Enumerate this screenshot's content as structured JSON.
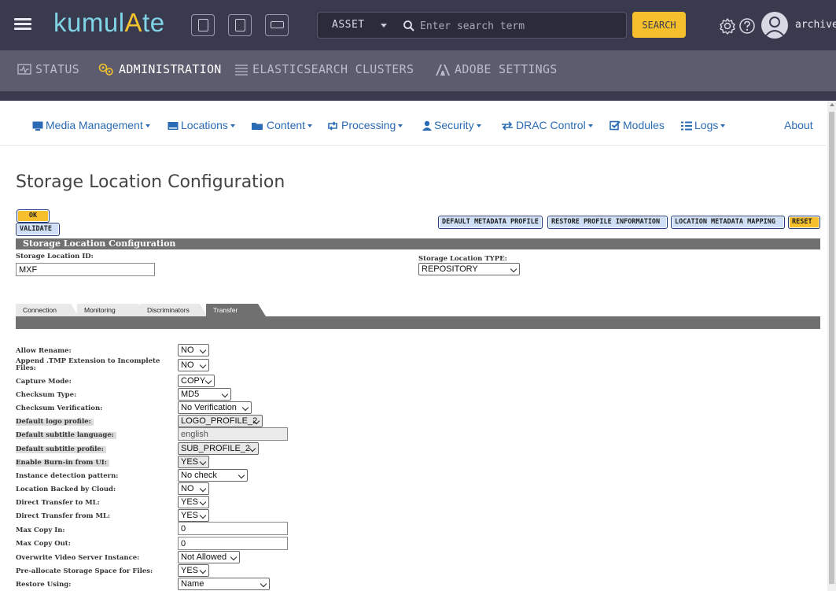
{
  "app": {
    "logo_text_1": "kumul",
    "logo_text_2": "A",
    "logo_text_3": "te",
    "user": "archiver"
  },
  "search": {
    "scope": "ASSET",
    "placeholder": "Enter search term",
    "button": "SEARCH"
  },
  "subnav": {
    "status": "STATUS",
    "administration": "ADMINISTRATION",
    "elasticsearch": "ELASTICSEARCH CLUSTERS",
    "adobe": "ADOBE SETTINGS"
  },
  "menu": {
    "media": "Media Management",
    "locations": "Locations",
    "content": "Content",
    "processing": "Processing",
    "security": "Security",
    "drac": "DRAC Control",
    "modules": "Modules",
    "logs": "Logs",
    "about": "About"
  },
  "page": {
    "title": "Storage Location Configuration"
  },
  "buttons": {
    "ok": "OK",
    "validate": "VALIDATE",
    "default_metadata": "DEFAULT METADATA PROFILE",
    "restore_profile": "RESTORE PROFILE INFORMATION",
    "location_mapping": "LOCATION METADATA MAPPING",
    "reset": "RESET"
  },
  "section": {
    "header": "Storage Location Configuration",
    "id_label": "Storage Location ID:",
    "id_value": "MXF",
    "type_label": "Storage Location TYPE:",
    "type_value": "REPOSITORY"
  },
  "tabs": [
    "Connection",
    "Monitoring",
    "Discriminators",
    "Transfer"
  ],
  "rows": [
    {
      "label": "Allow Rename:",
      "value": "NO"
    },
    {
      "label": "Append .TMP Extension to Incomplete",
      "label2": "Files:",
      "value": "NO"
    },
    {
      "label": "Capture Mode:",
      "value": "COPY"
    },
    {
      "label": "Checksum Type:",
      "value": "MD5"
    },
    {
      "label": "Checksum Verification:",
      "value": "No Verification"
    },
    {
      "label": "Default logo profile:",
      "value": "LOGO_PROFILE_2"
    },
    {
      "label": "Default subtitle language:",
      "value": "english"
    },
    {
      "label": "Default subtitle profile:",
      "value": "SUB_PROFILE_2"
    },
    {
      "label": "Enable Burn-in from UI:",
      "value": "YES"
    },
    {
      "label": "Instance detection pattern:",
      "value": "No check"
    },
    {
      "label": "Location Backed by Cloud:",
      "value": "NO"
    },
    {
      "label": "Direct Transfer to ML:",
      "value": "YES"
    },
    {
      "label": "Direct Transfer from ML:",
      "value": "YES"
    },
    {
      "label": "Max Copy In:",
      "value": "0"
    },
    {
      "label": "Max Copy Out:",
      "value": "0"
    },
    {
      "label": "Overwrite Video Server Instance:",
      "value": "Not Allowed"
    },
    {
      "label": "Pre-allocate Storage Space for Files:",
      "value": "YES"
    },
    {
      "label": "Restore Using:",
      "value": "Name"
    }
  ],
  "colors": {
    "topbar": "#3a3a4f",
    "subnav": "#5c5c6e",
    "accent_yellow": "#f5c02b",
    "logo_cyan": "#7fd4e6",
    "link_blue": "#2a6bb3",
    "section_gray": "#707070"
  },
  "icons": {
    "menu": "hamburger-icon",
    "search": "magnifier-icon",
    "settings": "gear-icon",
    "help": "question-icon",
    "user": "person-icon"
  }
}
